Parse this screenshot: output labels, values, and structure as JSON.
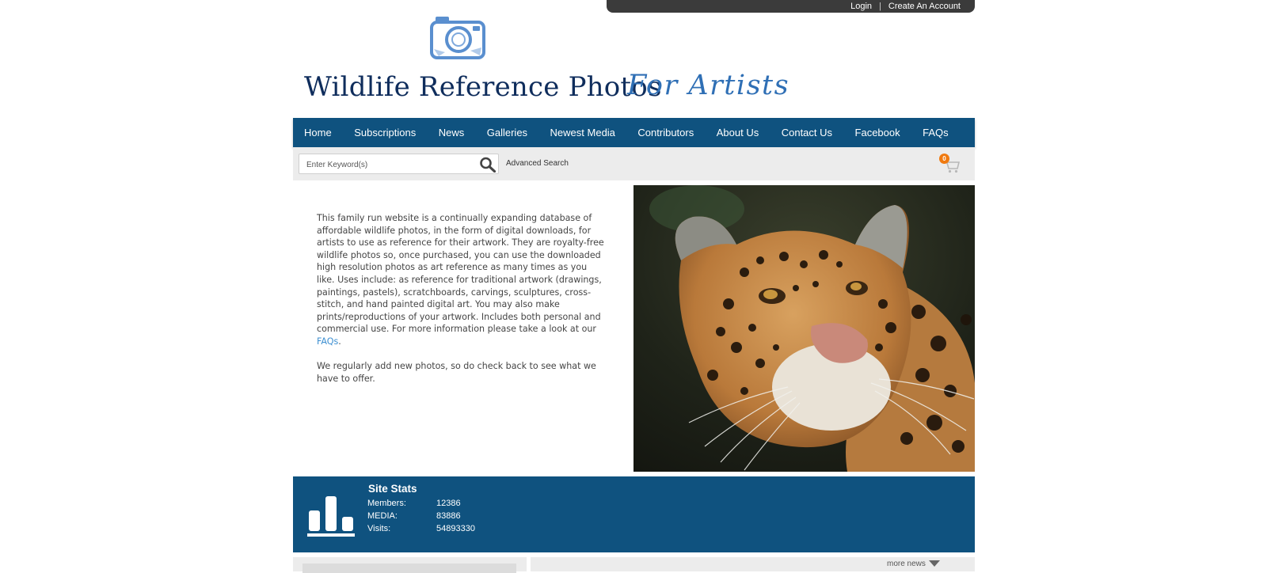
{
  "account": {
    "login": "Login",
    "separator": "|",
    "create": "Create An Account"
  },
  "logo": {
    "title": "Wildlife Reference Photos",
    "subtitle": "For Artists"
  },
  "nav": {
    "items": [
      "Home",
      "Subscriptions",
      "News",
      "Galleries",
      "Newest Media",
      "Contributors",
      "About Us",
      "Contact Us",
      "Facebook",
      "FAQs"
    ]
  },
  "search": {
    "placeholder": "Enter Keyword(s)",
    "value": "",
    "advanced": "Advanced Search"
  },
  "cart": {
    "count": "0"
  },
  "intro": {
    "p1": "This family run website is a continually expanding database of affordable wildlife photos, in the form of digital downloads, for artists to use as reference for their artwork. They are royalty-free wildlife photos so, once purchased, you can use the downloaded high resolution photos as art reference as many times as you like. Uses include: as reference for traditional artwork (drawings, paintings, pastels), scratchboards, carvings, sculptures, cross-stitch, and hand painted digital art. You may also make prints/reproductions of your artwork. Includes both personal and commercial use. For more information please take a look at our ",
    "p1_link": "FAQs",
    "p1_end": ".",
    "p2": "We regularly add new photos, so do check back to see what we have to offer."
  },
  "hero": {
    "icon": "jaguar-photo"
  },
  "stats": {
    "title": "Site Stats",
    "rows": [
      {
        "label": "Members:",
        "value": "12386"
      },
      {
        "label": "MEDIA:",
        "value": "83886"
      },
      {
        "label": "Visits:",
        "value": "54893330"
      }
    ]
  },
  "news": {
    "more": "more news"
  },
  "colors": {
    "nav": "#0f527f",
    "topbar": "#3b3b3b",
    "logo_title": "#0f2d5c",
    "logo_sub": "#2f6fb5",
    "link": "#3d8fd1",
    "cart_badge": "#f07a10"
  }
}
